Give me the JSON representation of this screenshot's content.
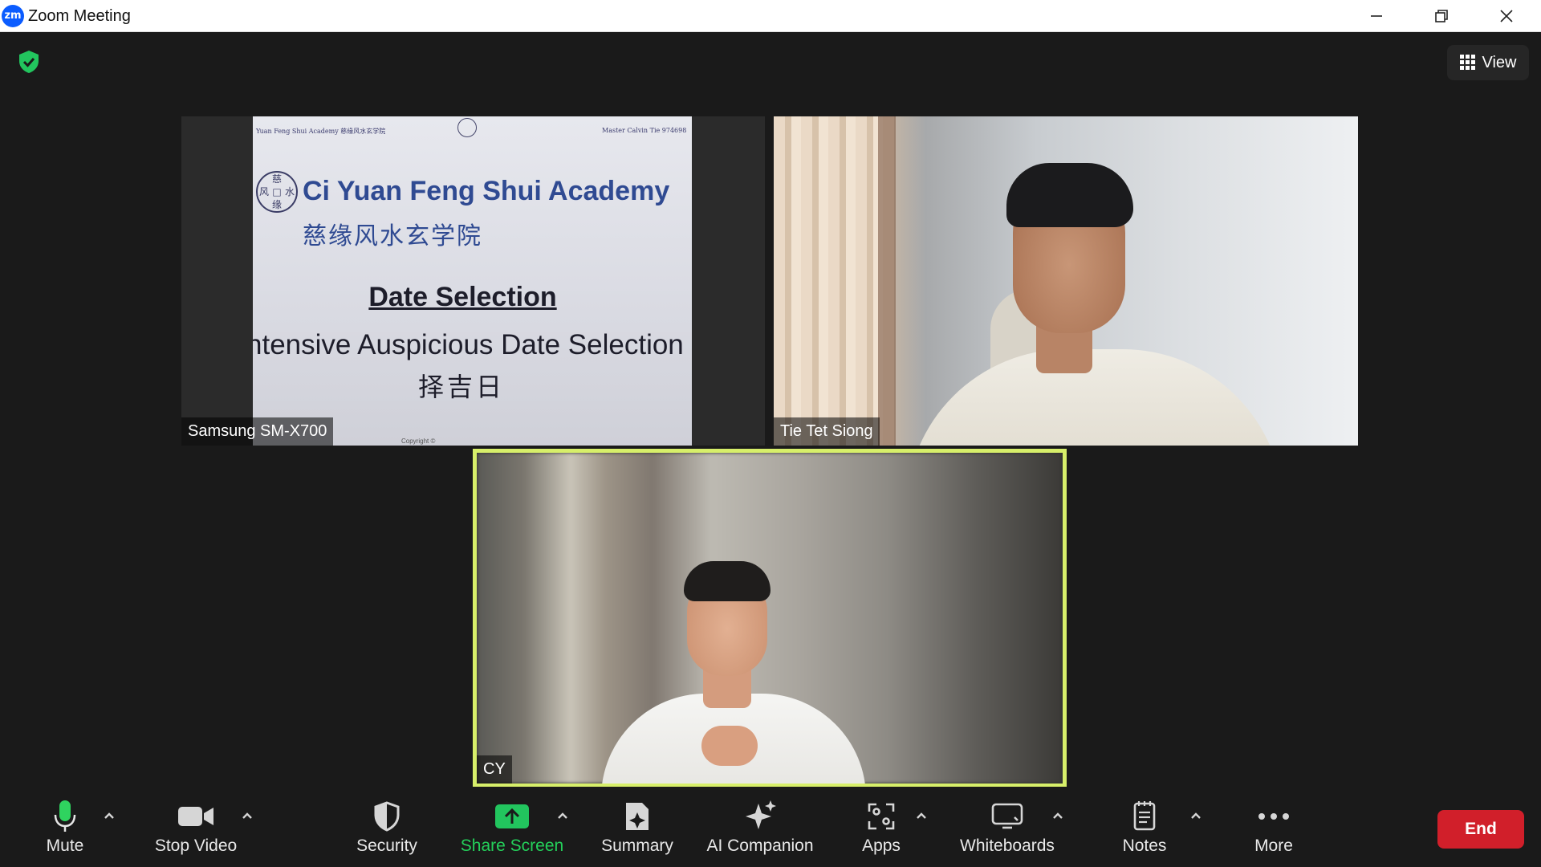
{
  "window": {
    "app_icon": "zm",
    "title": "Zoom Meeting",
    "controls": [
      "minimize-icon",
      "restore-icon",
      "close-icon"
    ]
  },
  "meeting": {
    "encryption_icon": "shield-check-icon",
    "view_button_label": "View",
    "accent_colors": {
      "active_speaker_border": "#d7ef6a",
      "share_green": "#24d05a",
      "end_red": "#d11f2a"
    }
  },
  "participants": [
    {
      "name": "Samsung SM-X700",
      "shared_document": {
        "header_left": "Yuan Feng Shui Academy 慈缘风水玄学院",
        "header_right": "Master Calvin Tie 974698",
        "seal_text": [
          "慈",
          "风",
          "水",
          "缘"
        ],
        "academy_name": "Ci Yuan Feng Shui Academy",
        "academy_name_cn": "慈缘风水玄学院",
        "title": "Date Selection",
        "subtitle": "ntensive Auspicious Date Selection",
        "subtitle_cn": "择吉日",
        "footer": "Copyright ©"
      }
    },
    {
      "name": "Tie Tet Siong"
    },
    {
      "name": "CY",
      "active_speaker": true
    }
  ],
  "toolbar": {
    "mute": "Mute",
    "stop_video": "Stop Video",
    "security": "Security",
    "share_screen": "Share Screen",
    "summary": "Summary",
    "ai_companion": "AI Companion",
    "apps": "Apps",
    "whiteboards": "Whiteboards",
    "notes": "Notes",
    "more": "More",
    "end": "End"
  }
}
